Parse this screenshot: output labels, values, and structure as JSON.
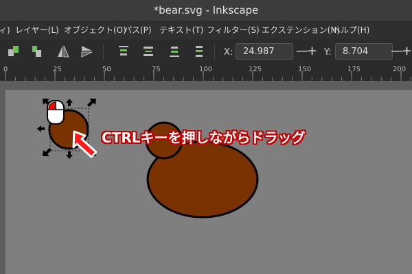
{
  "window": {
    "title": "*bear.svg - Inkscape"
  },
  "menu": {
    "items": [
      "ィ)",
      "レイヤー(L)",
      "オブジェクト(O)",
      "パス(P)",
      "テキスト(T)",
      "フィルター(S)",
      "エクステンション(N)",
      "ヘルプ(H)"
    ]
  },
  "toolbar": {
    "x_label": "X:",
    "x_value": "24.987",
    "y_label": "Y:",
    "y_value": "8.704",
    "minus": "—",
    "plus": "+"
  },
  "ruler": {
    "labels": [
      "0",
      "25",
      "50",
      "75",
      "100",
      "125",
      "150",
      "175",
      "200"
    ]
  },
  "annotation": {
    "text": "CTRLキーを押しながらドラッグ"
  },
  "colors": {
    "bear_fill": "#7a3300",
    "arrow": "#ff1a1a",
    "mouse_button": "#ff0000"
  },
  "icons": [
    "raise-to-top-icon",
    "raise-icon",
    "flip-horizontal-icon",
    "flip-vertical-icon",
    "align-top-icon",
    "align-center-icon",
    "align-bottom-icon",
    "distribute-icon",
    "mouse-icon",
    "scale-arrow-icon"
  ]
}
